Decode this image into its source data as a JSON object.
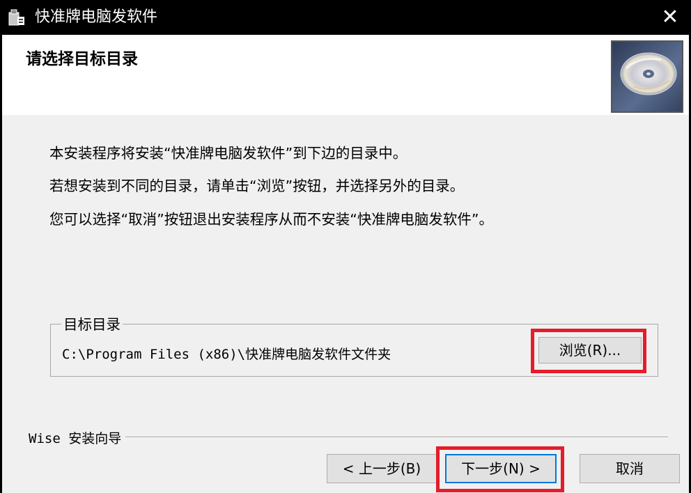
{
  "window": {
    "title": "快准牌电脑发软件",
    "close_glyph": "✕"
  },
  "header": {
    "title": "请选择目标目录",
    "image_icon": "cd-disc-icon"
  },
  "intro": {
    "line1": "本安装程序将安装“快准牌电脑发软件”到下边的目录中。",
    "line2": "若想安装到不同的目录，请单击“浏览”按钮，并选择另外的目录。",
    "line3": "您可以选择“取消”按钮退出安装程序从而不安装“快准牌电脑发软件”。"
  },
  "destination": {
    "group_label": "目标目录",
    "path": "C:\\Program Files (x86)\\快准牌电脑发软件文件夹",
    "browse_label": "浏览(R)..."
  },
  "footer": {
    "wizard_label": "Wise 安装向导",
    "back_label": "< 上一步(B)",
    "next_label": "下一步(N) >",
    "cancel_label": "取消"
  },
  "colors": {
    "highlight": "#e41c2b",
    "dialog_bg": "#f0f0f0",
    "button_bg": "#e1e1e1"
  }
}
